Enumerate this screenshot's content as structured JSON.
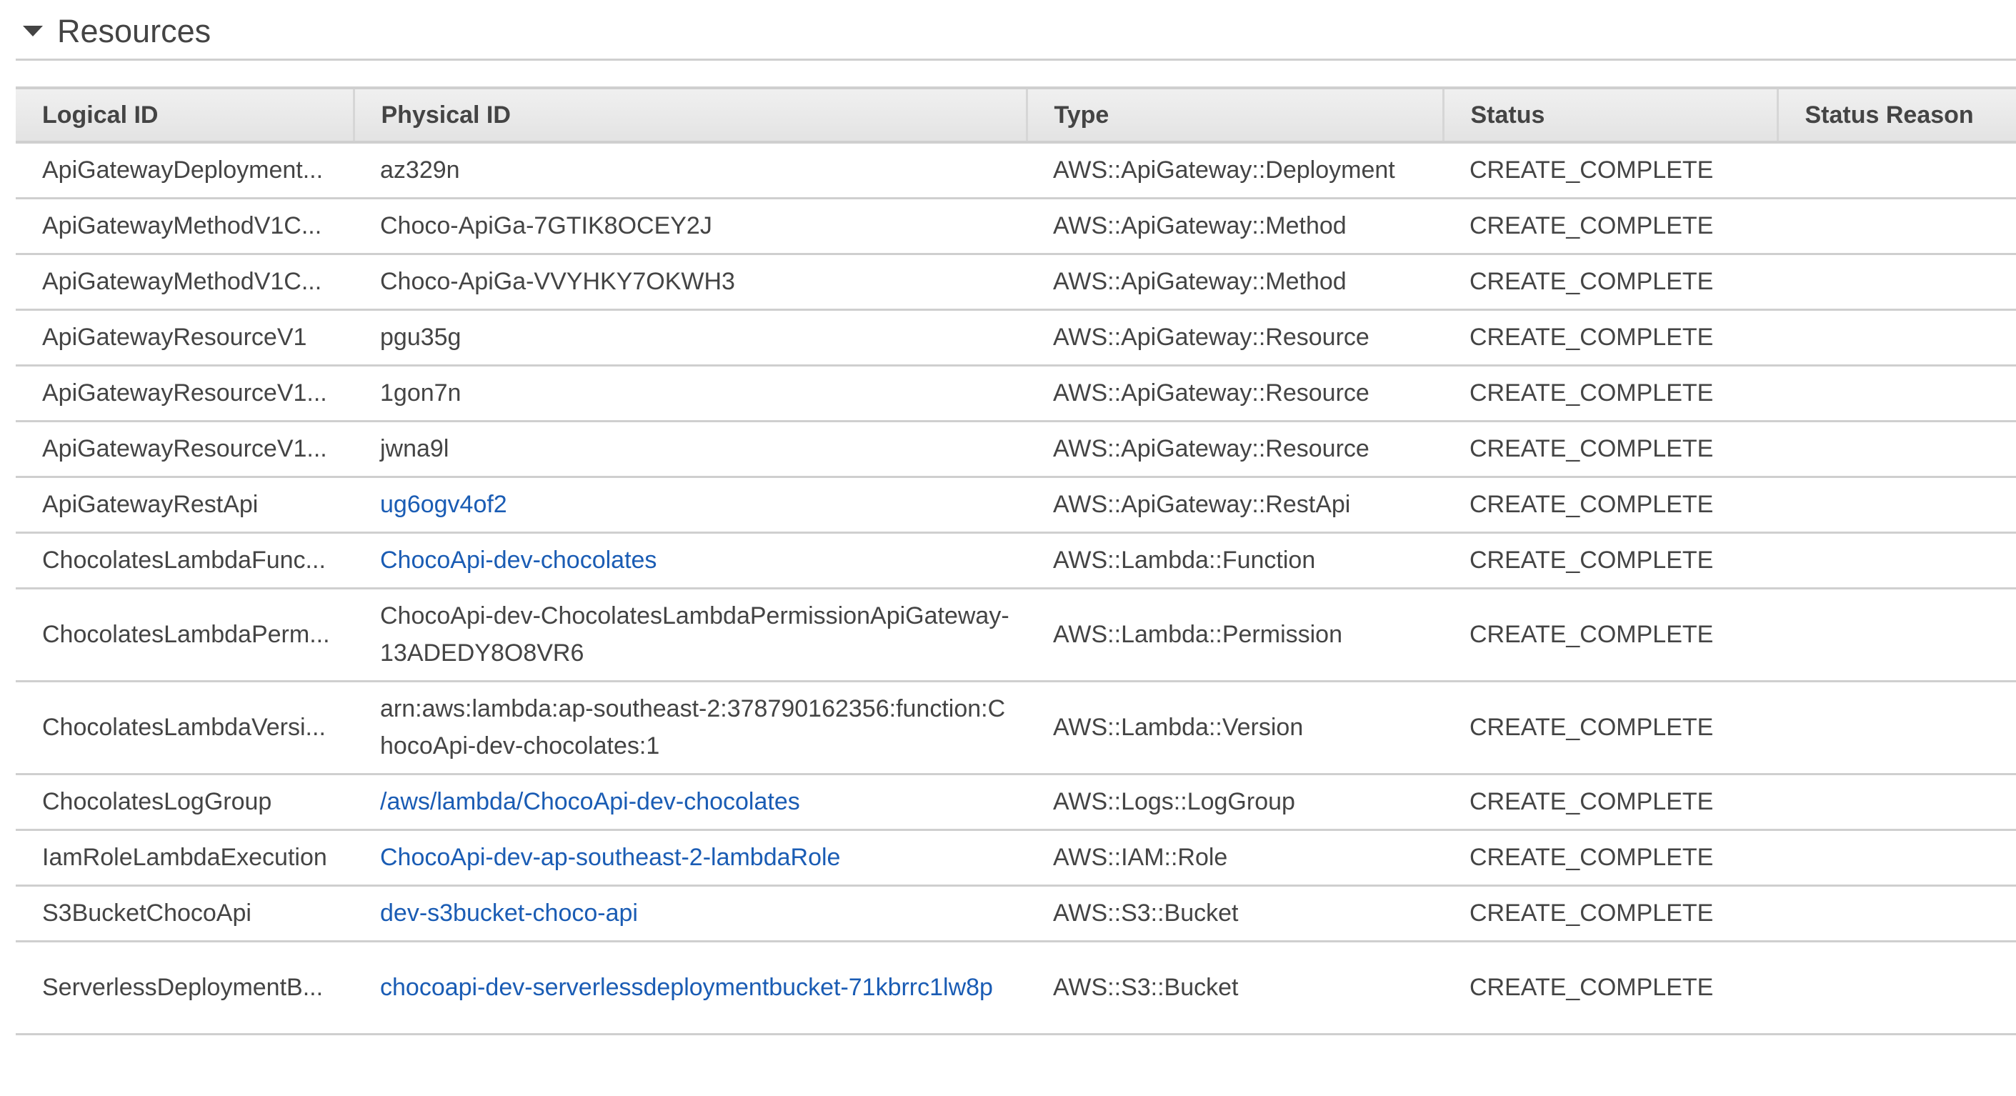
{
  "section": {
    "title": "Resources",
    "toggle_icon": "caret-down-icon",
    "expanded": true
  },
  "colors": {
    "link": "#1a5cb4",
    "status_complete": "#1a9a2e",
    "text": "#444444"
  },
  "table": {
    "columns": [
      "Logical ID",
      "Physical ID",
      "Type",
      "Status",
      "Status Reason"
    ],
    "rows": [
      {
        "logical_id": "ApiGatewayDeployment...",
        "physical_id": "az329n",
        "physical_is_link": false,
        "type": "AWS::ApiGateway::Deployment",
        "status": "CREATE_COMPLETE",
        "status_reason": ""
      },
      {
        "logical_id": "ApiGatewayMethodV1C...",
        "physical_id": "Choco-ApiGa-7GTIK8OCEY2J",
        "physical_is_link": false,
        "type": "AWS::ApiGateway::Method",
        "status": "CREATE_COMPLETE",
        "status_reason": ""
      },
      {
        "logical_id": "ApiGatewayMethodV1C...",
        "physical_id": "Choco-ApiGa-VVYHKY7OKWH3",
        "physical_is_link": false,
        "type": "AWS::ApiGateway::Method",
        "status": "CREATE_COMPLETE",
        "status_reason": ""
      },
      {
        "logical_id": "ApiGatewayResourceV1",
        "physical_id": "pgu35g",
        "physical_is_link": false,
        "type": "AWS::ApiGateway::Resource",
        "status": "CREATE_COMPLETE",
        "status_reason": ""
      },
      {
        "logical_id": "ApiGatewayResourceV1...",
        "physical_id": "1gon7n",
        "physical_is_link": false,
        "type": "AWS::ApiGateway::Resource",
        "status": "CREATE_COMPLETE",
        "status_reason": ""
      },
      {
        "logical_id": "ApiGatewayResourceV1...",
        "physical_id": "jwna9l",
        "physical_is_link": false,
        "type": "AWS::ApiGateway::Resource",
        "status": "CREATE_COMPLETE",
        "status_reason": ""
      },
      {
        "logical_id": "ApiGatewayRestApi",
        "physical_id": "ug6ogv4of2",
        "physical_is_link": true,
        "type": "AWS::ApiGateway::RestApi",
        "status": "CREATE_COMPLETE",
        "status_reason": ""
      },
      {
        "logical_id": "ChocolatesLambdaFunc...",
        "physical_id": "ChocoApi-dev-chocolates",
        "physical_is_link": true,
        "type": "AWS::Lambda::Function",
        "status": "CREATE_COMPLETE",
        "status_reason": ""
      },
      {
        "logical_id": "ChocolatesLambdaPerm...",
        "physical_id": "ChocoApi-dev-ChocolatesLambdaPermissionApiGateway-13ADEDY8O8VR6",
        "physical_is_link": false,
        "type": "AWS::Lambda::Permission",
        "status": "CREATE_COMPLETE",
        "status_reason": ""
      },
      {
        "logical_id": "ChocolatesLambdaVersi...",
        "physical_id": "arn:aws:lambda:ap-southeast-2:378790162356:function:ChocoApi-dev-chocolates:1",
        "physical_is_link": false,
        "type": "AWS::Lambda::Version",
        "status": "CREATE_COMPLETE",
        "status_reason": ""
      },
      {
        "logical_id": "ChocolatesLogGroup",
        "physical_id": "/aws/lambda/ChocoApi-dev-chocolates",
        "physical_is_link": true,
        "type": "AWS::Logs::LogGroup",
        "status": "CREATE_COMPLETE",
        "status_reason": ""
      },
      {
        "logical_id": "IamRoleLambdaExecution",
        "physical_id": "ChocoApi-dev-ap-southeast-2-lambdaRole",
        "physical_is_link": true,
        "type": "AWS::IAM::Role",
        "status": "CREATE_COMPLETE",
        "status_reason": ""
      },
      {
        "logical_id": "S3BucketChocoApi",
        "physical_id": "dev-s3bucket-choco-api",
        "physical_is_link": true,
        "type": "AWS::S3::Bucket",
        "status": "CREATE_COMPLETE",
        "status_reason": ""
      },
      {
        "logical_id": "ServerlessDeploymentB...",
        "physical_id": "chocoapi-dev-serverlessdeploymentbucket-71kbrrc1lw8p",
        "physical_is_link": true,
        "type": "AWS::S3::Bucket",
        "status": "CREATE_COMPLETE",
        "status_reason": ""
      }
    ]
  }
}
